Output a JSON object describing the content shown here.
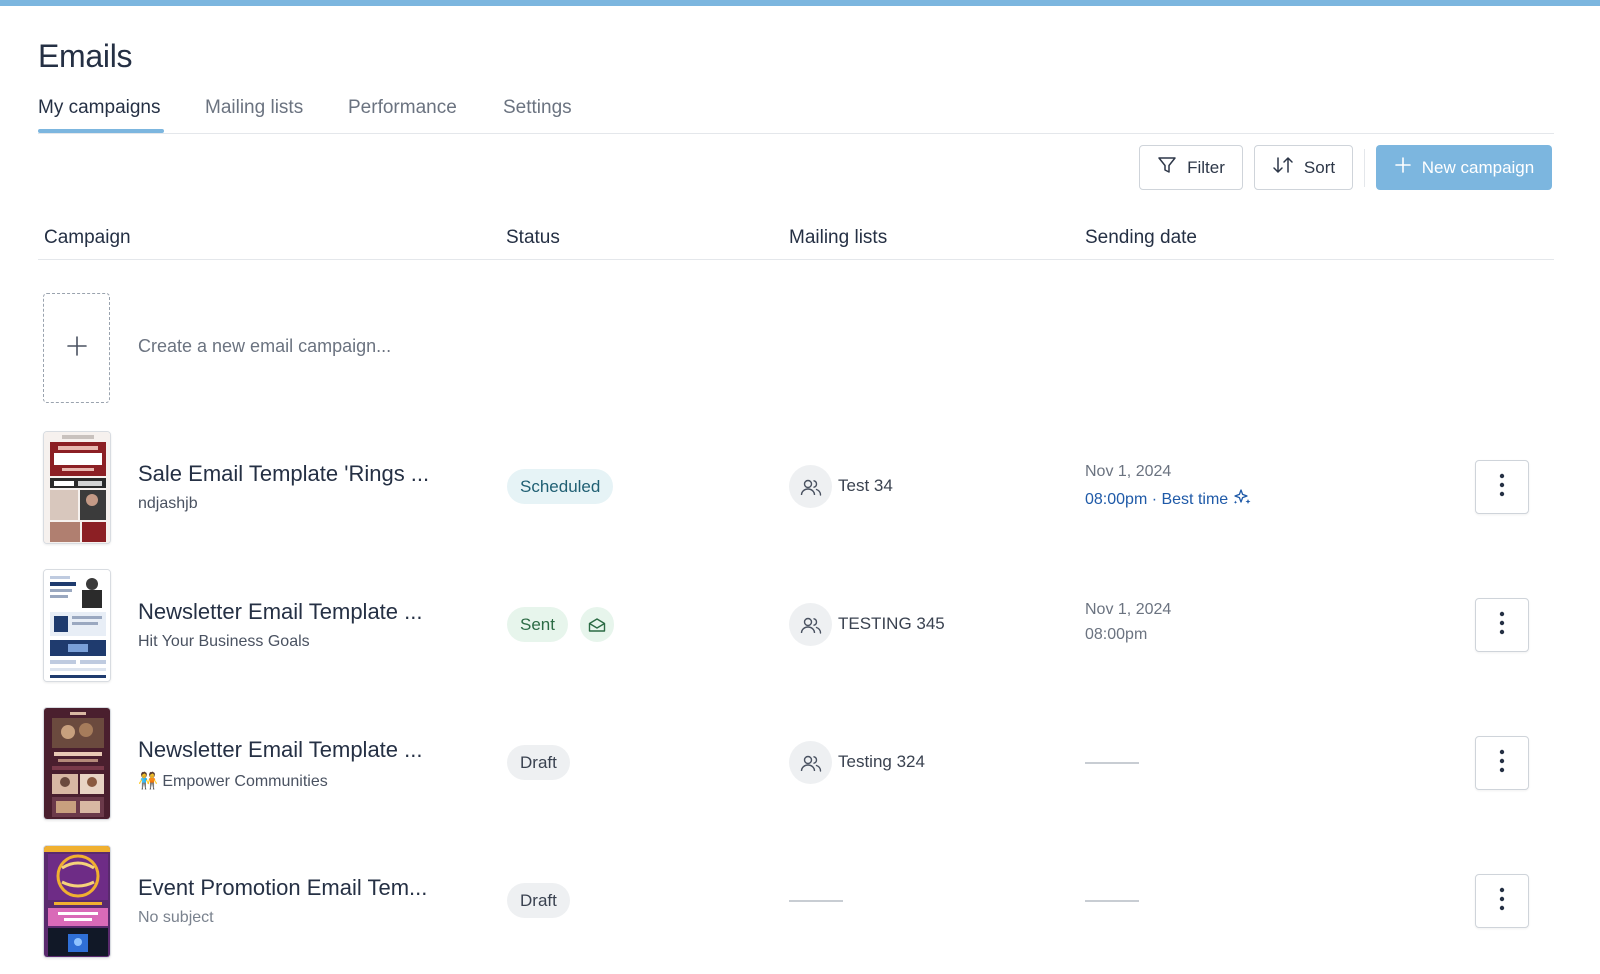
{
  "header": {
    "title": "Emails"
  },
  "tabs": [
    {
      "label": "My campaigns",
      "active": true
    },
    {
      "label": "Mailing lists",
      "active": false
    },
    {
      "label": "Performance",
      "active": false
    },
    {
      "label": "Settings",
      "active": false
    }
  ],
  "toolbar": {
    "filter_label": "Filter",
    "sort_label": "Sort",
    "new_campaign_label": "New campaign",
    "accent_color": "#7cb6df"
  },
  "table": {
    "columns": [
      "Campaign",
      "Status",
      "Mailing lists",
      "Sending date"
    ],
    "create_prompt": "Create a new email campaign...",
    "rows": [
      {
        "title": "Sale Email Template 'Rings ...",
        "subtitle": "ndjashjb",
        "status": "Scheduled",
        "mailing_list": "Test 34",
        "date": "Nov 1, 2024",
        "time": "08:00pm · Best time",
        "thumbnail": "valentines-sale-thumbnail"
      },
      {
        "title": "Newsletter Email Template ...",
        "subtitle": "Hit Your Business Goals",
        "status": "Sent",
        "mailing_list": "TESTING 345",
        "date": "Nov 1, 2024",
        "time": "08:00pm",
        "thumbnail": "business-newsletter-thumbnail"
      },
      {
        "title": "Newsletter Email Template ...",
        "subtitle": "🧑‍🤝‍🧑 Empower Communities",
        "status": "Draft",
        "mailing_list": "Testing 324",
        "date": "",
        "time": "",
        "thumbnail": "community-newsletter-thumbnail"
      },
      {
        "title": "Event Promotion Email Tem...",
        "subtitle": "No subject",
        "status": "Draft",
        "mailing_list": "",
        "date": "",
        "time": "",
        "thumbnail": "mardi-gras-thumbnail"
      }
    ]
  },
  "colors": {
    "scheduled_badge": "#e6f3f6",
    "sent_badge": "#e7f5ec",
    "draft_badge": "#eef0f2",
    "best_time_text": "#1f5aa8"
  }
}
